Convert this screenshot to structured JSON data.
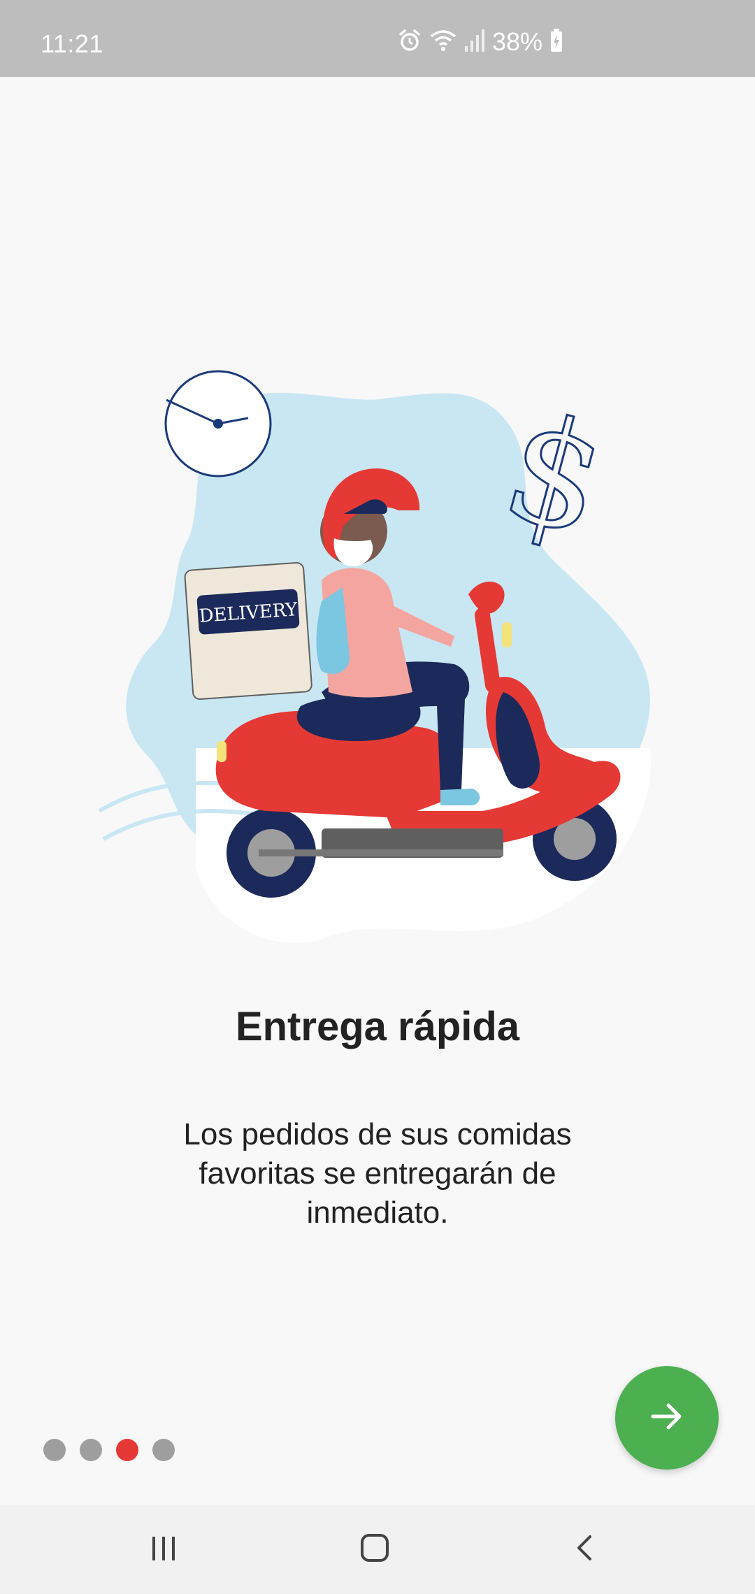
{
  "status_bar": {
    "time": "11:21",
    "battery_percent": "38%",
    "icons": [
      "alarm-icon",
      "wifi-icon",
      "signal-icon",
      "battery-charging-icon"
    ]
  },
  "onboarding": {
    "illustration_badge": "DELIVERY",
    "title": "Entrega rápida",
    "description": "Los pedidos de sus comidas favoritas se entregarán de inmediato.",
    "page_count": 4,
    "current_page": 3,
    "next_icon": "arrow-right-icon"
  },
  "navigation": {
    "buttons": [
      "recent-apps-icon",
      "home-icon",
      "back-icon"
    ]
  },
  "colors": {
    "accent_green": "#4caf50",
    "active_dot": "#e53935",
    "inactive_dot": "#9e9e9e",
    "status_bar": "#bdbdbd"
  }
}
